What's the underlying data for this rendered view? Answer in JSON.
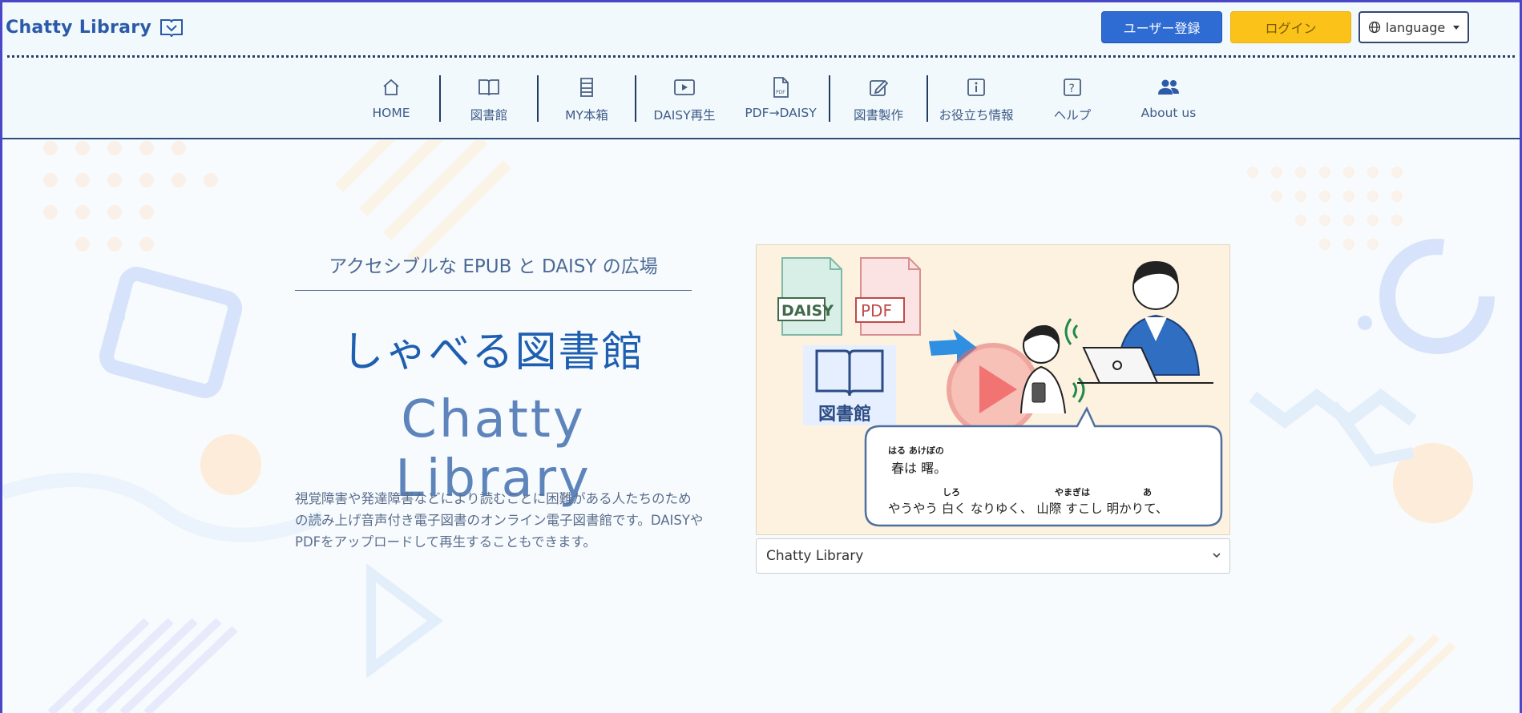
{
  "header": {
    "logo_text": "Chatty Library",
    "register_label": "ユーザー登録",
    "login_label": "ログイン",
    "language_label": "language"
  },
  "nav": {
    "items": [
      {
        "label": "HOME",
        "icon": "home-icon"
      },
      {
        "label": "図書館",
        "icon": "book-icon"
      },
      {
        "label": "MY本箱",
        "icon": "bookshelf-icon"
      },
      {
        "label": "DAISY再生",
        "icon": "play-icon"
      },
      {
        "label": "PDF→DAISY",
        "icon": "pdf-file-icon"
      },
      {
        "label": "図書製作",
        "icon": "edit-icon"
      },
      {
        "label": "お役立ち情報",
        "icon": "info-icon"
      },
      {
        "label": "ヘルプ",
        "icon": "help-icon"
      },
      {
        "label": "About us",
        "icon": "users-icon"
      }
    ]
  },
  "hero": {
    "subtitle": "アクセシブルな EPUB と DAISY の広場",
    "title_jp": "しゃべる図書館",
    "title_en": "Chatty Library",
    "description": "視覚障害や発達障害などにより読むことに困難がある人たちのための読み上げ音声付き電子図書のオンライン電子図書館です。DAISYやPDFをアップロードして再生することもできます。"
  },
  "illustration": {
    "daisy_label": "DAISY",
    "pdf_label": "PDF",
    "library_label": "図書館",
    "ruby1": "はる あけぼの",
    "line1": "春は 曙。",
    "ruby2a": "しろ",
    "ruby2b": "やまぎは",
    "ruby2c": "あ",
    "line2": "やうやう 白く なりゆく、 山際 すこし 明かりて、"
  },
  "selector": {
    "selected": "Chatty Library"
  },
  "colors": {
    "primary": "#2e6bd2",
    "login": "#fbc21a",
    "brand_text": "#1f5fb1"
  }
}
